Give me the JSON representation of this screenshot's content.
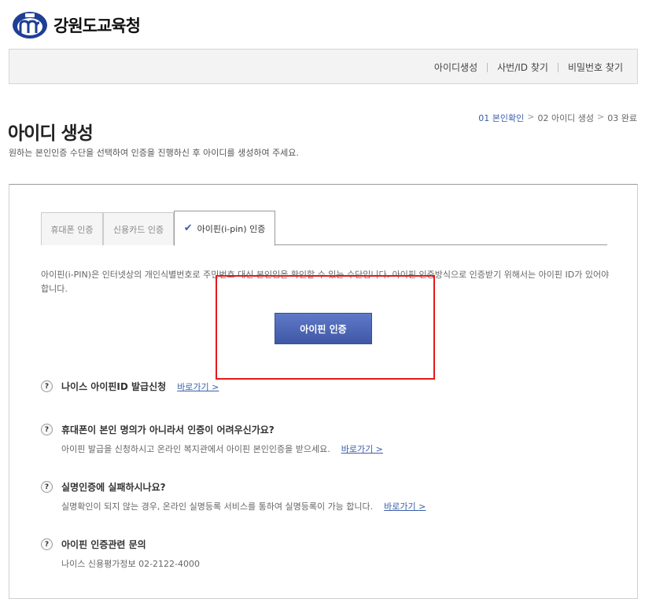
{
  "header": {
    "logo_text": "강원도교육청",
    "logo_icon": "education-office-emblem-icon"
  },
  "topnav": {
    "items": [
      "아이디생성",
      "사번/ID 찾기",
      "비밀번호 찾기"
    ]
  },
  "steps": {
    "step1": "01 본인확인",
    "step2": "02 아이디 생성",
    "step3": "03 완료",
    "arrow": ">"
  },
  "page": {
    "title": "아이디 생성",
    "description": "원하는 본인인증 수단을 선택하여 인증을 진행하신 후 아이디를 생성하여 주세요."
  },
  "tabs": {
    "phone": "휴대폰 인증",
    "card": "신용카드 인증",
    "ipin": "아이핀(i-pin) 인증",
    "active_check": "✔"
  },
  "ipin": {
    "description": "아이핀(i-PIN)은 인터넷상의 개인식별번호로 주민번호 대신 본인임을 확인할 수 있는 수단입니다. 아이핀 인증방식으로 인증받기 위해서는 아이핀 ID가 있어야 합니다.",
    "button": "아이핀 인증"
  },
  "faq": {
    "q_mark": "?",
    "link_label": "바로가기 >",
    "item1_title": "나이스 아이핀ID 발급신청",
    "item2_title": "휴대폰이 본인 명의가 아니라서 인증이 어려우신가요?",
    "item2_text": "아이핀 발급을 신청하시고 온라인 복지관에서 아이핀 본인인증을 받으세요.",
    "item3_title": "실명인증에 실패하시나요?",
    "item3_text": "실명확인이 되지 않는 경우, 온라인 실명등록 서비스를 통하여 실명등록이 가능 합니다.",
    "item4_title": "아이핀 인증관련 문의",
    "item4_text": "나이스 신용평가정보 02-2122-4000"
  },
  "colors": {
    "accent": "#3a5ea8",
    "button": "#4a63b4",
    "highlight_box": "#e31a1a"
  }
}
